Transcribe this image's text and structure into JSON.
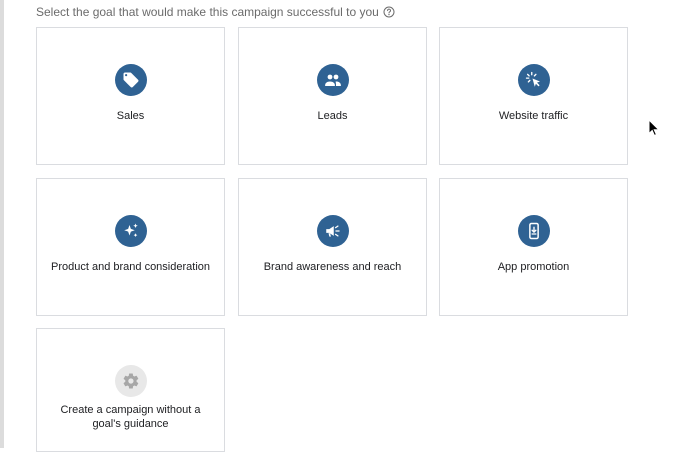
{
  "prompt": {
    "text": "Select the goal that would make this campaign successful to you",
    "icon": "help-circle-icon"
  },
  "goals": [
    {
      "label": "Sales",
      "icon": "tag-icon"
    },
    {
      "label": "Leads",
      "icon": "people-icon"
    },
    {
      "label": "Website traffic",
      "icon": "cursor-click-icon"
    },
    {
      "label": "Product and brand consideration",
      "icon": "sparkle-icon"
    },
    {
      "label": "Brand awareness and reach",
      "icon": "megaphone-icon"
    },
    {
      "label": "App promotion",
      "icon": "phone-download-icon"
    },
    {
      "label": "Create a campaign without a goal's guidance",
      "icon": "gear-icon"
    }
  ],
  "colors": {
    "accent": "#2f6293",
    "card_border": "#dadce0",
    "muted_icon_bg": "#e8e8e8"
  }
}
